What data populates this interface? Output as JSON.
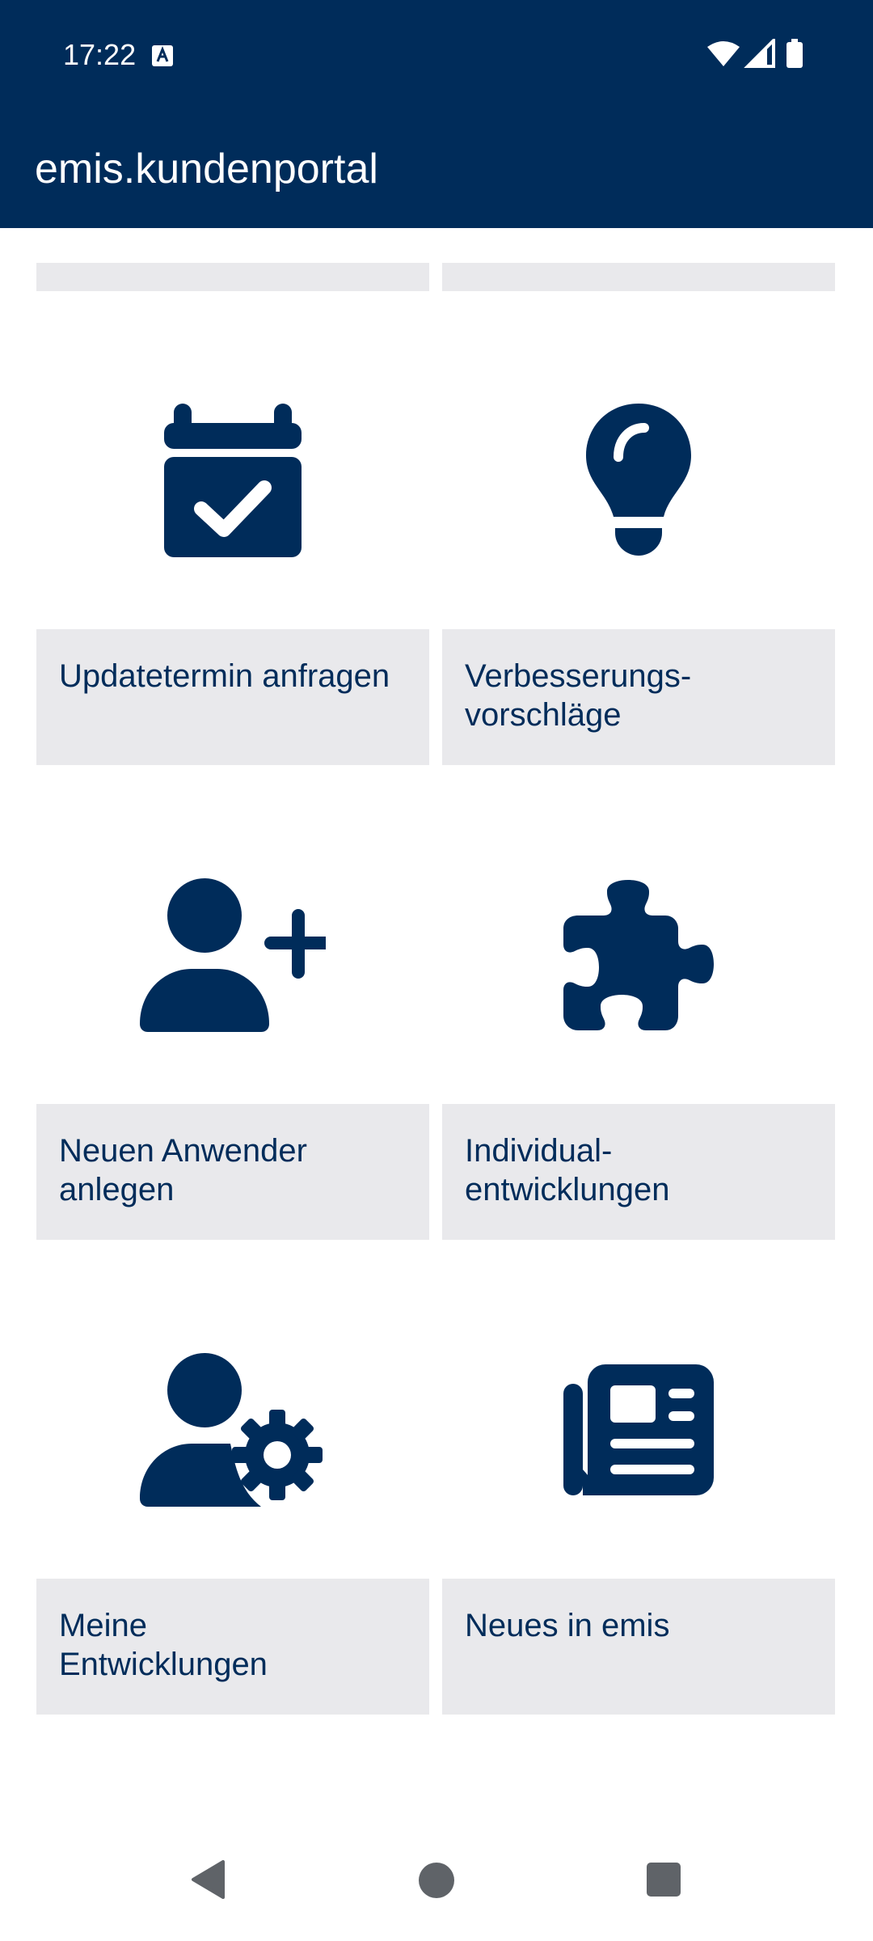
{
  "status_bar": {
    "time": "17:22",
    "icons": [
      "text-a-icon",
      "wifi-icon",
      "signal-icon",
      "battery-icon"
    ]
  },
  "app_bar": {
    "title": "emis.kundenportal"
  },
  "colors": {
    "primary": "#002c5a",
    "tile_bg": "#e9e9ec",
    "background": "#ffffff",
    "nav_icon": "#5f6368"
  },
  "tiles": [
    {
      "label": "Updatetermin anfragen",
      "icon": "calendar-check-icon"
    },
    {
      "label": "Verbesserungs-\nvorschläge",
      "icon": "lightbulb-icon"
    },
    {
      "label": "Neuen Anwender\nanlegen",
      "icon": "user-plus-icon"
    },
    {
      "label": "Individual-\nentwicklungen",
      "icon": "puzzle-piece-icon"
    },
    {
      "label": "Meine\nEntwicklungen",
      "icon": "user-gear-icon"
    },
    {
      "label": "Neues in emis",
      "icon": "newspaper-icon"
    }
  ],
  "nav_bar": {
    "icons": [
      "back-icon",
      "home-icon",
      "recents-icon"
    ]
  }
}
